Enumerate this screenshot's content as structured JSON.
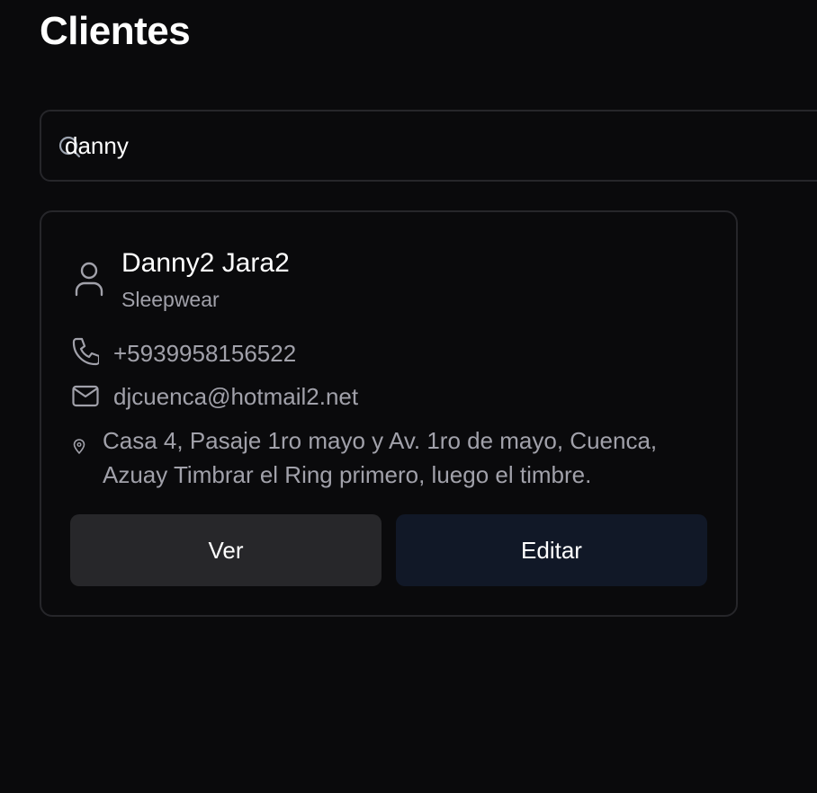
{
  "header": {
    "title": "Clientes"
  },
  "search": {
    "value": "danny",
    "icon": "search-icon"
  },
  "client": {
    "name": "Danny2 Jara2",
    "category": "Sleepwear",
    "phone": "+5939958156522",
    "email": "djcuenca@hotmail2.net",
    "address_line1": "Casa 4, Pasaje 1ro mayo y Av. 1ro de mayo, Cuenca,",
    "address_line2": "Azuay Timbrar el Ring primero, luego el timbre.",
    "icons": {
      "avatar": "user-icon",
      "phone": "phone-icon",
      "email": "mail-icon",
      "address": "map-pin-icon"
    }
  },
  "actions": {
    "view_label": "Ver",
    "edit_label": "Editar"
  },
  "colors": {
    "background": "#0a0a0c",
    "border": "#26262a",
    "muted_text": "#a1a1aa",
    "view_button": "#27272a",
    "edit_button": "#111827"
  }
}
